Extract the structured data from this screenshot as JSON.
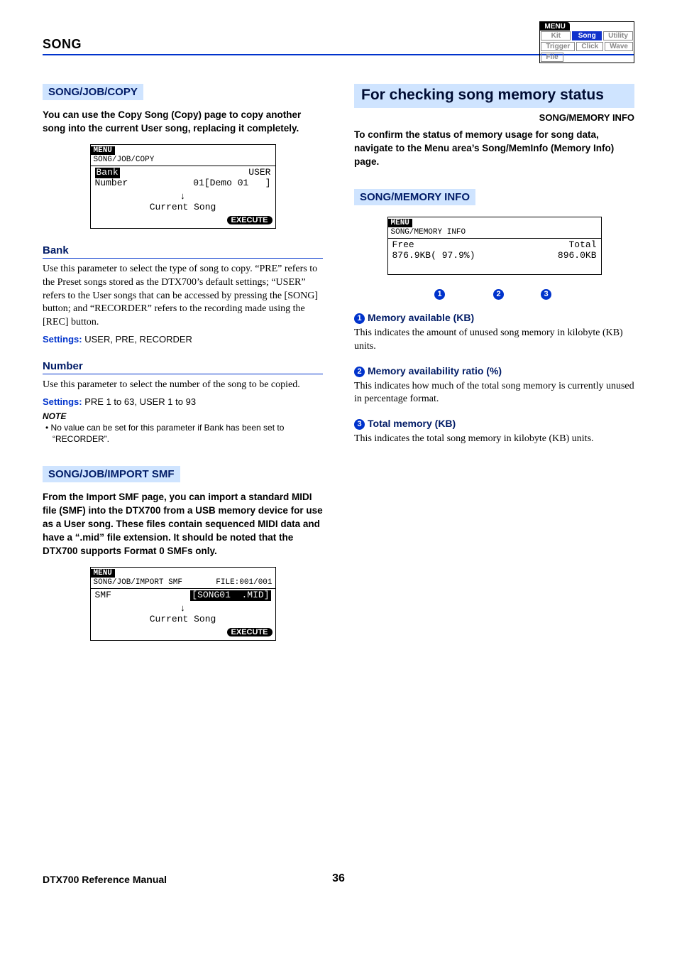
{
  "topmenu": {
    "header": "MENU",
    "row1": [
      "Kit",
      "Song",
      "Utility"
    ],
    "row2": [
      "Trigger",
      "Click",
      "Wave"
    ],
    "row3": [
      "File"
    ],
    "active": "Song"
  },
  "section": "SONG",
  "left": {
    "copy": {
      "heading": "SONG/JOB/COPY",
      "intro": "You can use the Copy Song (Copy) page to copy another song into the current User song, replacing it completely.",
      "lcd": {
        "menu": "MENU",
        "path": "SONG/JOB/COPY",
        "l1": "Bank",
        "l1r": "USER",
        "l2": "Number",
        "l2r": "01[Demo 01   ]",
        "l3": "Current Song",
        "exec": "EXECUTE"
      },
      "bank": {
        "heading": "Bank",
        "text": "Use this parameter to select the type of song to copy. “PRE” refers to the Preset songs stored as the DTX700’s default settings; “USER” refers to the User songs that can be accessed by pressing the [SONG] button; and “RECORDER” refers to the recording made using the [REC] button.",
        "settings_label": "Settings:",
        "settings_value": "USER, PRE, RECORDER"
      },
      "number": {
        "heading": "Number",
        "text": "Use this parameter to select the number of the song to be copied.",
        "settings_label": "Settings:",
        "settings_value": "PRE 1 to 63, USER 1 to 93",
        "note_h": "NOTE",
        "note": "• No value can be set for this parameter if Bank has been set to “RECORDER”."
      }
    },
    "import": {
      "heading": "SONG/JOB/IMPORT SMF",
      "intro": "From the Import SMF page, you can import a standard MIDI file (SMF) into the DTX700 from a USB memory device for use as a User song. These files contain sequenced MIDI data and have a “.mid” file extension. It should be noted that the DTX700 supports Format 0 SMFs only.",
      "lcd": {
        "menu": "MENU",
        "path": "SONG/JOB/IMPORT SMF",
        "pathR": "FILE:001/001",
        "l1": "SMF",
        "l1r": "[SONG01  .MID]",
        "l2": "Current Song",
        "exec": "EXECUTE"
      }
    }
  },
  "right": {
    "title": "For checking song memory status",
    "subtitle": "SONG/MEMORY INFO",
    "intro": "To confirm the status of memory usage for song data, navigate to the Menu area’s Song/MemInfo (Memory Info) page.",
    "section_heading": "SONG/MEMORY INFO",
    "lcd": {
      "menu": "MENU",
      "path": "SONG/MEMORY INFO",
      "free_l": "Free",
      "free_v": "876.9KB( 97.9%)",
      "tot_l": "Total",
      "tot_v": "896.0KB"
    },
    "items": [
      {
        "n": "1",
        "title": "Memory available (KB)",
        "text": "This indicates the amount of unused song memory in kilobyte (KB) units."
      },
      {
        "n": "2",
        "title": "Memory availability ratio (%)",
        "text": "This indicates how much of the total song memory is currently unused in percentage format."
      },
      {
        "n": "3",
        "title": "Total memory (KB)",
        "text": "This indicates the total song memory in kilobyte (KB) units."
      }
    ]
  },
  "footer": {
    "left": "DTX700  Reference Manual",
    "page": "36"
  }
}
